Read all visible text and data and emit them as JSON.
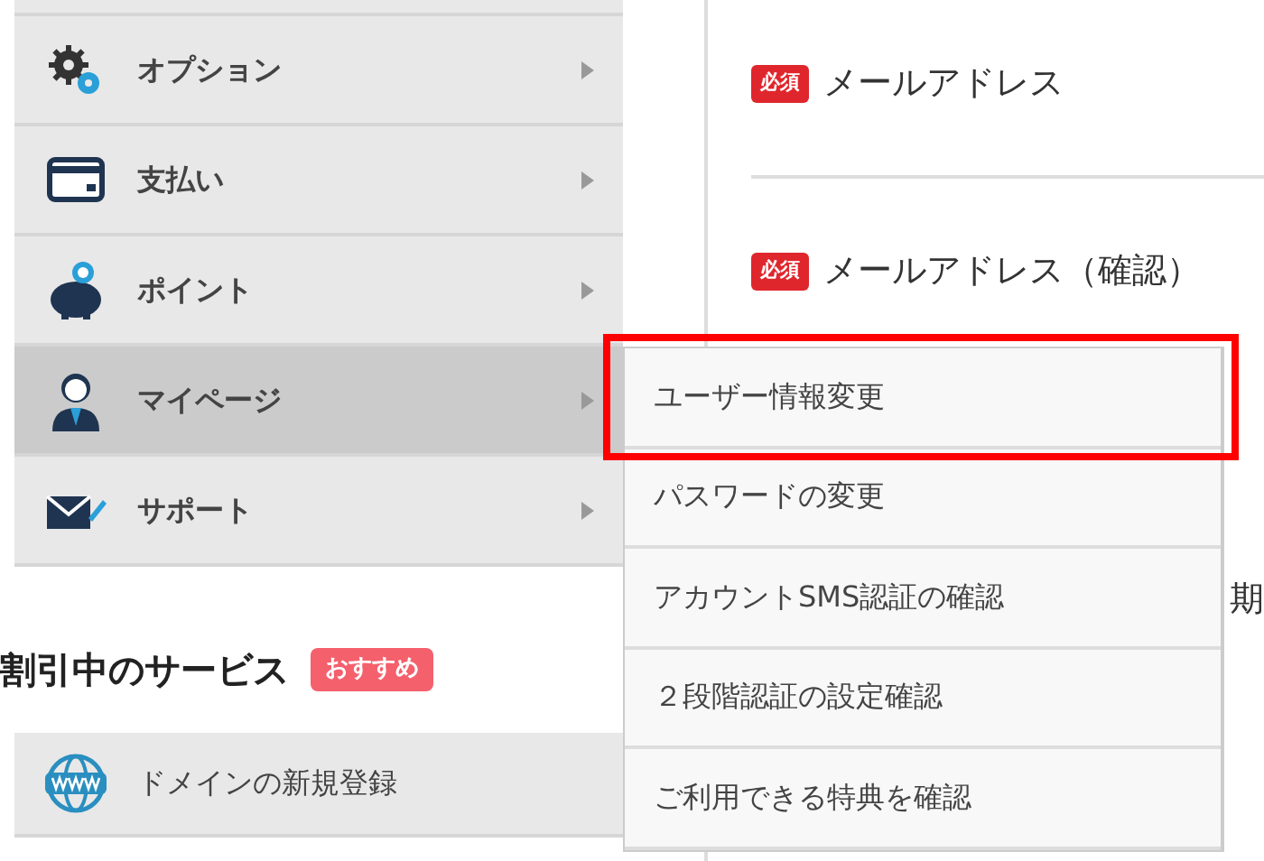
{
  "sidebar": {
    "items": [
      {
        "label": "オプション",
        "kind": "gears",
        "selected": false
      },
      {
        "label": "支払い",
        "kind": "card",
        "selected": false
      },
      {
        "label": "ポイント",
        "kind": "piggy",
        "selected": false
      },
      {
        "label": "マイページ",
        "kind": "user",
        "selected": true
      },
      {
        "label": "サポート",
        "kind": "mail",
        "selected": false
      }
    ]
  },
  "discount_section": {
    "title": "割引中のサービス",
    "badge": "おすすめ",
    "items": [
      {
        "label": "ドメインの新規登録",
        "kind": "www"
      }
    ]
  },
  "form": {
    "fields": [
      {
        "badge": "必須",
        "label": "メールアドレス"
      },
      {
        "badge": "必須",
        "label": "メールアドレス（確認）"
      }
    ],
    "column_3": "期"
  },
  "submenu": {
    "items": [
      {
        "label": "ユーザー情報変更",
        "highlighted": true
      },
      {
        "label": "パスワードの変更",
        "highlighted": false
      },
      {
        "label": "アカウントSMS認証の確認",
        "highlighted": false
      },
      {
        "label": "２段階認証の設定確認",
        "highlighted": false
      },
      {
        "label": "ご利用できる特典を確認",
        "highlighted": false
      }
    ]
  }
}
